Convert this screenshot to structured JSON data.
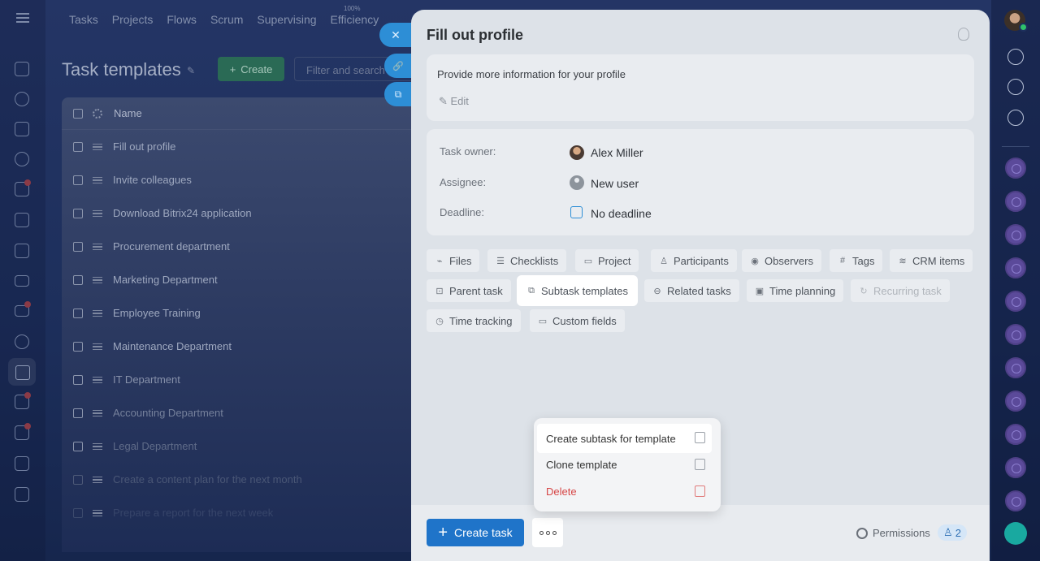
{
  "topnav": {
    "items": [
      "Tasks",
      "Projects",
      "Flows",
      "Scrum",
      "Supervising",
      "Efficiency"
    ],
    "efficiency_percent": "100%"
  },
  "page": {
    "title": "Task templates",
    "create_label": "Create",
    "filter_placeholder": "Filter and search"
  },
  "grid": {
    "column_name": "Name",
    "rows": [
      "Fill out profile",
      "Invite colleagues",
      "Download Bitrix24 application",
      "Procurement department",
      "Marketing Department",
      "Employee Training",
      "Maintenance Department",
      "IT Department",
      "Accounting Department",
      "Legal Department",
      "Create a content plan for the next month",
      "Prepare a report for the next week"
    ]
  },
  "side_buttons": {
    "close": "✕",
    "link": "🔗",
    "open": "⧉"
  },
  "panel": {
    "title": "Fill out profile",
    "description": "Provide more information for your profile",
    "edit_label": "Edit",
    "fields": {
      "owner_label": "Task owner:",
      "owner_value": "Alex Miller",
      "assignee_label": "Assignee:",
      "assignee_value": "New user",
      "deadline_label": "Deadline:",
      "deadline_value": "No deadline"
    },
    "chips": {
      "files": "Files",
      "checklists": "Checklists",
      "project": "Project",
      "participants": "Participants",
      "observers": "Observers",
      "tags": "Tags",
      "crm": "CRM items",
      "parent": "Parent task",
      "subtask_templates": "Subtask templates",
      "related": "Related tasks",
      "time_planning": "Time planning",
      "recurring": "Recurring task",
      "time_tracking": "Time tracking",
      "custom_fields": "Custom fields"
    },
    "footer": {
      "create_task": "Create task",
      "permissions": "Permissions",
      "permissions_count": "2"
    }
  },
  "menu": {
    "create_subtask": "Create subtask for template",
    "clone": "Clone template",
    "delete": "Delete"
  },
  "colors": {
    "accent": "#1f74c9",
    "success": "#2a6a55",
    "danger": "#d64545"
  }
}
